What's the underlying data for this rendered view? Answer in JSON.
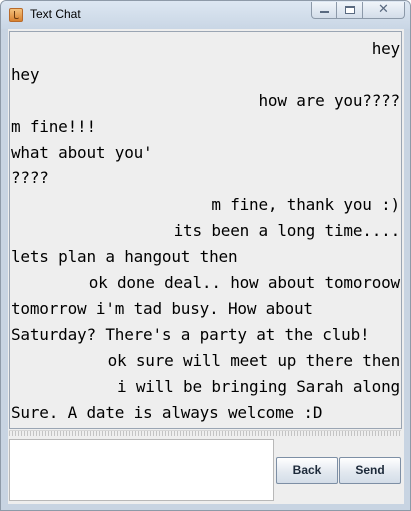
{
  "window": {
    "title": "Text Chat"
  },
  "chat": {
    "messages": [
      {
        "text": "hey",
        "align": "right"
      },
      {
        "text": "hey",
        "align": "left"
      },
      {
        "text": "how are you????",
        "align": "right"
      },
      {
        "text": "m fine!!!",
        "align": "left"
      },
      {
        "text": "what about you'",
        "align": "left"
      },
      {
        "text": "????",
        "align": "left"
      },
      {
        "text": "m fine, thank you :)",
        "align": "right"
      },
      {
        "text": "its been a long time....",
        "align": "right"
      },
      {
        "text": "lets plan a hangout then",
        "align": "left"
      },
      {
        "text": "ok done deal.. how about tomoroow",
        "align": "right"
      },
      {
        "text": "tomorrow i'm tad busy. How about",
        "align": "left"
      },
      {
        "text": "Saturday? There's a party at the club!",
        "align": "left"
      },
      {
        "text": "ok sure will meet up there then",
        "align": "right"
      },
      {
        "text": "i will be bringing Sarah along",
        "align": "right"
      },
      {
        "text": "Sure. A date is always welcome :D",
        "align": "left"
      }
    ]
  },
  "compose": {
    "value": ""
  },
  "buttons": {
    "back_label": "Back",
    "send_label": "Send"
  }
}
